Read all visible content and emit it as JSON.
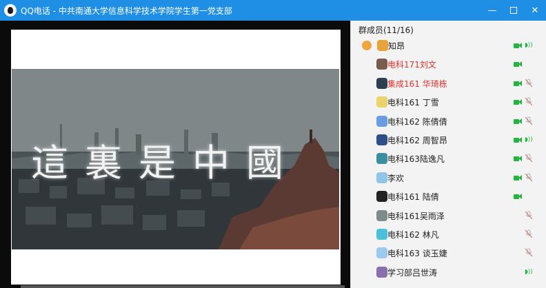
{
  "window": {
    "title": "QQ电话 - 中共南通大学信息科学技术学院学生第一党支部"
  },
  "video": {
    "title_chars": [
      "這",
      "裏",
      "是",
      "中",
      "國"
    ]
  },
  "panel": {
    "header": "群成员(11/16)",
    "members": [
      {
        "name": "知昂",
        "red": false,
        "video": true,
        "mic": "speaking",
        "avatar": "user-avatar-orange"
      },
      {
        "name": "电科171刘文",
        "red": true,
        "video": true,
        "mic": "none",
        "avatar": "user-avatar-photo"
      },
      {
        "name": "集成161  华琦栋",
        "red": true,
        "video": true,
        "mic": "muted",
        "avatar": "user-avatar-dark"
      },
      {
        "name": "电科161 丁雪",
        "red": false,
        "video": true,
        "mic": "muted",
        "avatar": "user-avatar-yellow"
      },
      {
        "name": "电科162    陈倩倩",
        "red": false,
        "video": true,
        "mic": "muted",
        "avatar": "user-avatar-blue"
      },
      {
        "name": "电科162  周智昂",
        "red": false,
        "video": true,
        "mic": "speaking",
        "avatar": "user-avatar-navy"
      },
      {
        "name": "电科163陆逸凡",
        "red": false,
        "video": true,
        "mic": "muted",
        "avatar": "user-avatar-teal"
      },
      {
        "name": "李欢",
        "red": false,
        "video": true,
        "mic": "muted",
        "avatar": "user-avatar-sky"
      },
      {
        "name": "电科161 陆倩",
        "red": false,
        "video": true,
        "mic": "none",
        "avatar": "user-avatar-black"
      },
      {
        "name": "电科161吴雨泽",
        "red": false,
        "video": false,
        "mic": "muted",
        "avatar": "user-avatar-grey"
      },
      {
        "name": "电科162 林凡",
        "red": false,
        "video": false,
        "mic": "muted",
        "avatar": "user-avatar-cyan"
      },
      {
        "name": "电科163 谈玉婕",
        "red": false,
        "video": false,
        "mic": "muted",
        "avatar": "user-avatar-lightblue"
      },
      {
        "name": "学习部吕世涛",
        "red": false,
        "video": false,
        "mic": "speaking",
        "avatar": "user-avatar-purple"
      }
    ]
  },
  "colors": {
    "titlebar": "#1f8fe6",
    "accent_green": "#26b33f",
    "red_name": "#e0302a"
  }
}
